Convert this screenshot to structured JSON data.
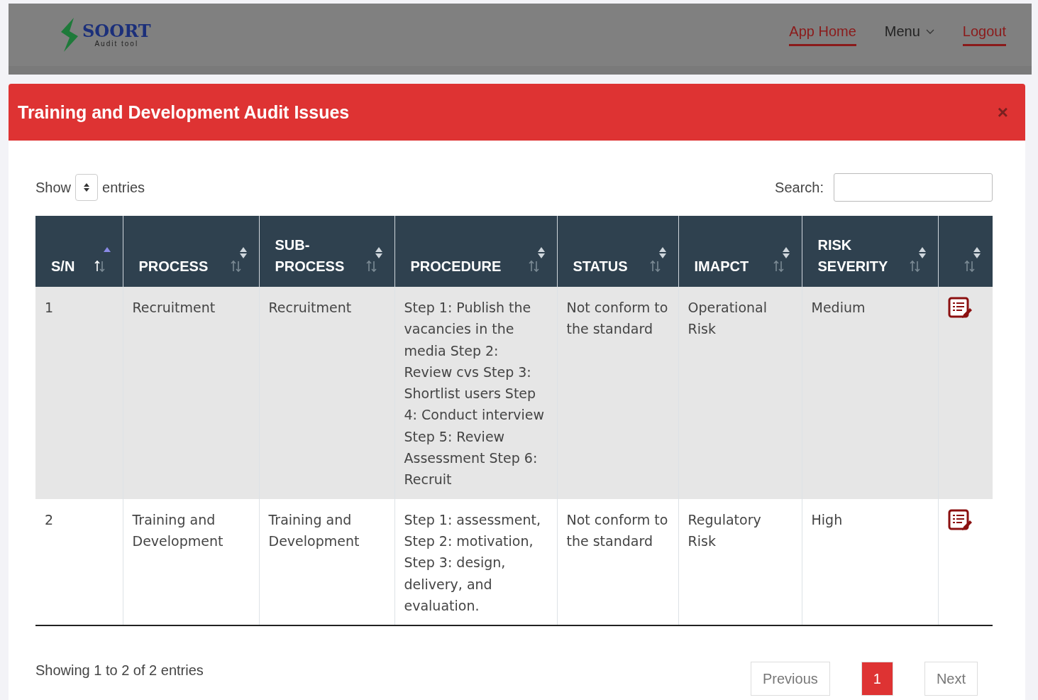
{
  "logo": {
    "name": "SOORT",
    "tagline": "Audit tool"
  },
  "nav": [
    {
      "label": "App Home",
      "kind": "link",
      "selected": true
    },
    {
      "label": "Menu",
      "kind": "dropdown",
      "selected": false
    },
    {
      "label": "Logout",
      "kind": "link",
      "selected": true
    }
  ],
  "modal": {
    "title": "Training and Development Audit Issues",
    "close": "×",
    "length": {
      "before": "Show",
      "after": "entries"
    },
    "search": {
      "label": "Search:"
    },
    "table": {
      "columns": [
        {
          "label": "S/N",
          "sorted": true
        },
        {
          "label": "PROCESS",
          "sorted": false
        },
        {
          "label": "SUB-PROCESS",
          "sorted": false
        },
        {
          "label": "PROCEDURE",
          "sorted": false
        },
        {
          "label": "STATUS",
          "sorted": false
        },
        {
          "label": "IMAPCT",
          "sorted": false
        },
        {
          "label": "RISK SEVERITY",
          "sorted": false
        },
        {
          "sorted": false
        }
      ],
      "rows": [
        {
          "cells": [
            "1",
            "Recruitment",
            "Recruitment",
            "Step 1: Publish the vacancies in the media Step 2: Review cvs Step 3: Shortlist users Step 4: Conduct interview Step 5: Review Assessment Step 6: Recruit",
            "Not conform to the standard",
            "Operational Risk",
            "Medium"
          ]
        },
        {
          "cells": [
            "2",
            "Training and Development",
            "Training and Development",
            "Step 1: assessment, Step 2: motivation, Step 3: design, delivery, and evaluation.",
            "Not conform to the standard",
            "Regulatory Risk",
            "High"
          ]
        }
      ]
    },
    "info": "Showing 1 to 2 of 2 entries",
    "pagination": [
      {
        "label": "Previous",
        "selected": false
      },
      {
        "label": "1",
        "selected": true
      },
      {
        "label": "Next",
        "selected": false
      }
    ]
  }
}
